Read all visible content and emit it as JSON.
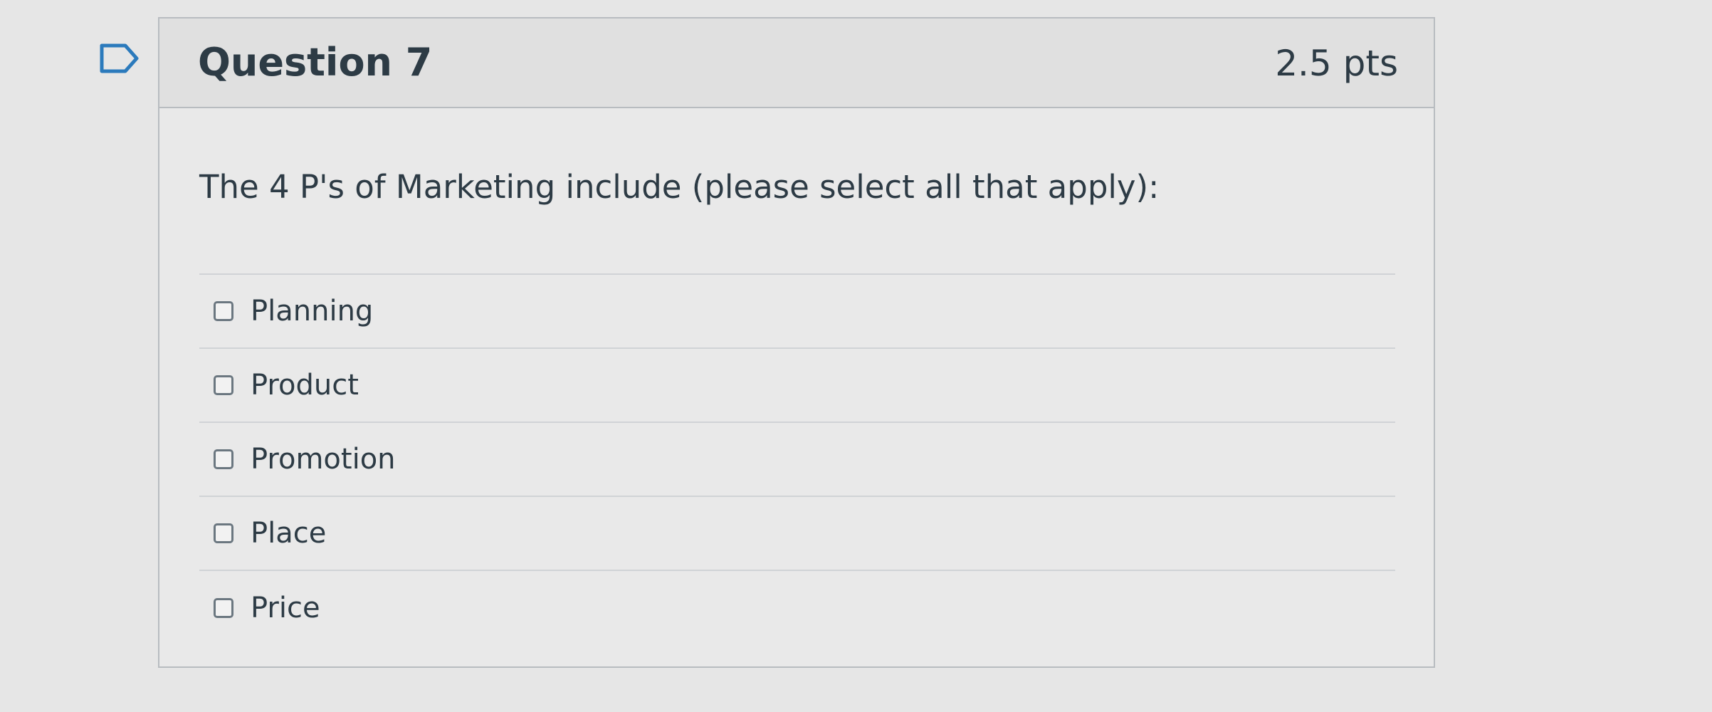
{
  "flag": {
    "icon": "flag-question-icon"
  },
  "question": {
    "title": "Question 7",
    "points": "2.5 pts",
    "text": "The 4 P's of Marketing include (please select all that apply):",
    "answers": [
      {
        "label": "Planning",
        "checked": false
      },
      {
        "label": "Product",
        "checked": false
      },
      {
        "label": "Promotion",
        "checked": false
      },
      {
        "label": "Place",
        "checked": false
      },
      {
        "label": "Price",
        "checked": false
      }
    ]
  }
}
